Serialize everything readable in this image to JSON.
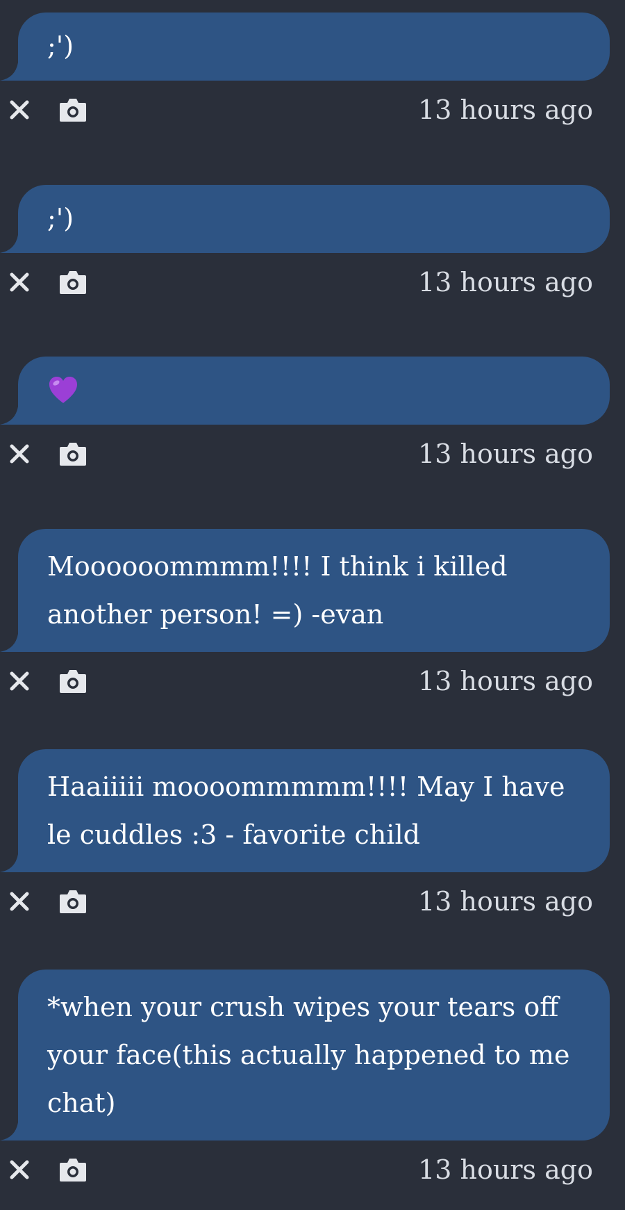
{
  "messages": [
    {
      "text": ";')",
      "timestamp": "13 hours ago"
    },
    {
      "text": ";')",
      "timestamp": "13 hours ago"
    },
    {
      "text": "💜",
      "timestamp": "13 hours ago",
      "is_emoji": true
    },
    {
      "text": "Moooooommmm!!!! I think i killed another person! =) -evan",
      "timestamp": "13 hours ago"
    },
    {
      "text": "Haaiiiii moooommmmm!!!! May I have le cuddles :3 - favorite child",
      "timestamp": "13 hours ago"
    },
    {
      "text": "*when your crush wipes your tears off your face(this actually happened to me chat)",
      "timestamp": "13 hours ago"
    }
  ],
  "icons": {
    "delete": "close-icon",
    "snapshot": "camera-icon"
  },
  "colors": {
    "background": "#2a2f3a",
    "bubble": "#2e5484",
    "text": "#ffffff",
    "timestamp": "#d9dde4",
    "icon": "#e6e8ec",
    "heart": "#9b3fd6"
  }
}
